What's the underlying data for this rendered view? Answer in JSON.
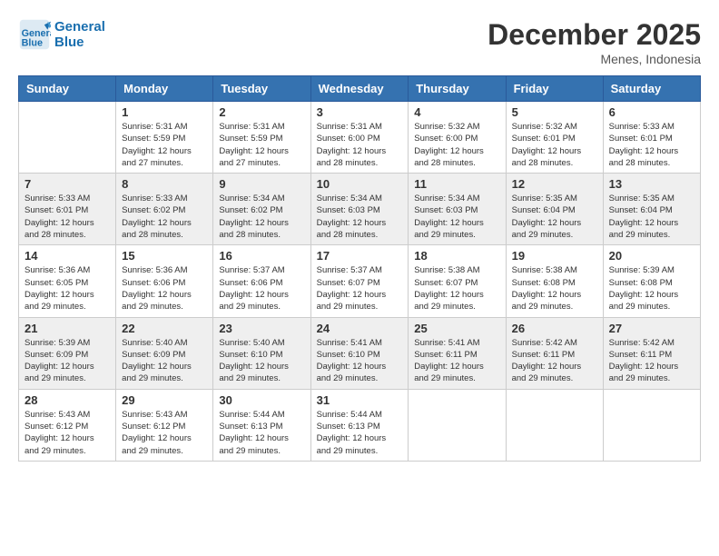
{
  "header": {
    "logo_line1": "General",
    "logo_line2": "Blue",
    "month": "December 2025",
    "location": "Menes, Indonesia"
  },
  "days_of_week": [
    "Sunday",
    "Monday",
    "Tuesday",
    "Wednesday",
    "Thursday",
    "Friday",
    "Saturday"
  ],
  "weeks": [
    [
      {
        "day": "",
        "info": ""
      },
      {
        "day": "1",
        "info": "Sunrise: 5:31 AM\nSunset: 5:59 PM\nDaylight: 12 hours\nand 27 minutes."
      },
      {
        "day": "2",
        "info": "Sunrise: 5:31 AM\nSunset: 5:59 PM\nDaylight: 12 hours\nand 27 minutes."
      },
      {
        "day": "3",
        "info": "Sunrise: 5:31 AM\nSunset: 6:00 PM\nDaylight: 12 hours\nand 28 minutes."
      },
      {
        "day": "4",
        "info": "Sunrise: 5:32 AM\nSunset: 6:00 PM\nDaylight: 12 hours\nand 28 minutes."
      },
      {
        "day": "5",
        "info": "Sunrise: 5:32 AM\nSunset: 6:01 PM\nDaylight: 12 hours\nand 28 minutes."
      },
      {
        "day": "6",
        "info": "Sunrise: 5:33 AM\nSunset: 6:01 PM\nDaylight: 12 hours\nand 28 minutes."
      }
    ],
    [
      {
        "day": "7",
        "info": "Sunrise: 5:33 AM\nSunset: 6:01 PM\nDaylight: 12 hours\nand 28 minutes."
      },
      {
        "day": "8",
        "info": "Sunrise: 5:33 AM\nSunset: 6:02 PM\nDaylight: 12 hours\nand 28 minutes."
      },
      {
        "day": "9",
        "info": "Sunrise: 5:34 AM\nSunset: 6:02 PM\nDaylight: 12 hours\nand 28 minutes."
      },
      {
        "day": "10",
        "info": "Sunrise: 5:34 AM\nSunset: 6:03 PM\nDaylight: 12 hours\nand 28 minutes."
      },
      {
        "day": "11",
        "info": "Sunrise: 5:34 AM\nSunset: 6:03 PM\nDaylight: 12 hours\nand 29 minutes."
      },
      {
        "day": "12",
        "info": "Sunrise: 5:35 AM\nSunset: 6:04 PM\nDaylight: 12 hours\nand 29 minutes."
      },
      {
        "day": "13",
        "info": "Sunrise: 5:35 AM\nSunset: 6:04 PM\nDaylight: 12 hours\nand 29 minutes."
      }
    ],
    [
      {
        "day": "14",
        "info": "Sunrise: 5:36 AM\nSunset: 6:05 PM\nDaylight: 12 hours\nand 29 minutes."
      },
      {
        "day": "15",
        "info": "Sunrise: 5:36 AM\nSunset: 6:06 PM\nDaylight: 12 hours\nand 29 minutes."
      },
      {
        "day": "16",
        "info": "Sunrise: 5:37 AM\nSunset: 6:06 PM\nDaylight: 12 hours\nand 29 minutes."
      },
      {
        "day": "17",
        "info": "Sunrise: 5:37 AM\nSunset: 6:07 PM\nDaylight: 12 hours\nand 29 minutes."
      },
      {
        "day": "18",
        "info": "Sunrise: 5:38 AM\nSunset: 6:07 PM\nDaylight: 12 hours\nand 29 minutes."
      },
      {
        "day": "19",
        "info": "Sunrise: 5:38 AM\nSunset: 6:08 PM\nDaylight: 12 hours\nand 29 minutes."
      },
      {
        "day": "20",
        "info": "Sunrise: 5:39 AM\nSunset: 6:08 PM\nDaylight: 12 hours\nand 29 minutes."
      }
    ],
    [
      {
        "day": "21",
        "info": "Sunrise: 5:39 AM\nSunset: 6:09 PM\nDaylight: 12 hours\nand 29 minutes."
      },
      {
        "day": "22",
        "info": "Sunrise: 5:40 AM\nSunset: 6:09 PM\nDaylight: 12 hours\nand 29 minutes."
      },
      {
        "day": "23",
        "info": "Sunrise: 5:40 AM\nSunset: 6:10 PM\nDaylight: 12 hours\nand 29 minutes."
      },
      {
        "day": "24",
        "info": "Sunrise: 5:41 AM\nSunset: 6:10 PM\nDaylight: 12 hours\nand 29 minutes."
      },
      {
        "day": "25",
        "info": "Sunrise: 5:41 AM\nSunset: 6:11 PM\nDaylight: 12 hours\nand 29 minutes."
      },
      {
        "day": "26",
        "info": "Sunrise: 5:42 AM\nSunset: 6:11 PM\nDaylight: 12 hours\nand 29 minutes."
      },
      {
        "day": "27",
        "info": "Sunrise: 5:42 AM\nSunset: 6:11 PM\nDaylight: 12 hours\nand 29 minutes."
      }
    ],
    [
      {
        "day": "28",
        "info": "Sunrise: 5:43 AM\nSunset: 6:12 PM\nDaylight: 12 hours\nand 29 minutes."
      },
      {
        "day": "29",
        "info": "Sunrise: 5:43 AM\nSunset: 6:12 PM\nDaylight: 12 hours\nand 29 minutes."
      },
      {
        "day": "30",
        "info": "Sunrise: 5:44 AM\nSunset: 6:13 PM\nDaylight: 12 hours\nand 29 minutes."
      },
      {
        "day": "31",
        "info": "Sunrise: 5:44 AM\nSunset: 6:13 PM\nDaylight: 12 hours\nand 29 minutes."
      },
      {
        "day": "",
        "info": ""
      },
      {
        "day": "",
        "info": ""
      },
      {
        "day": "",
        "info": ""
      }
    ]
  ]
}
